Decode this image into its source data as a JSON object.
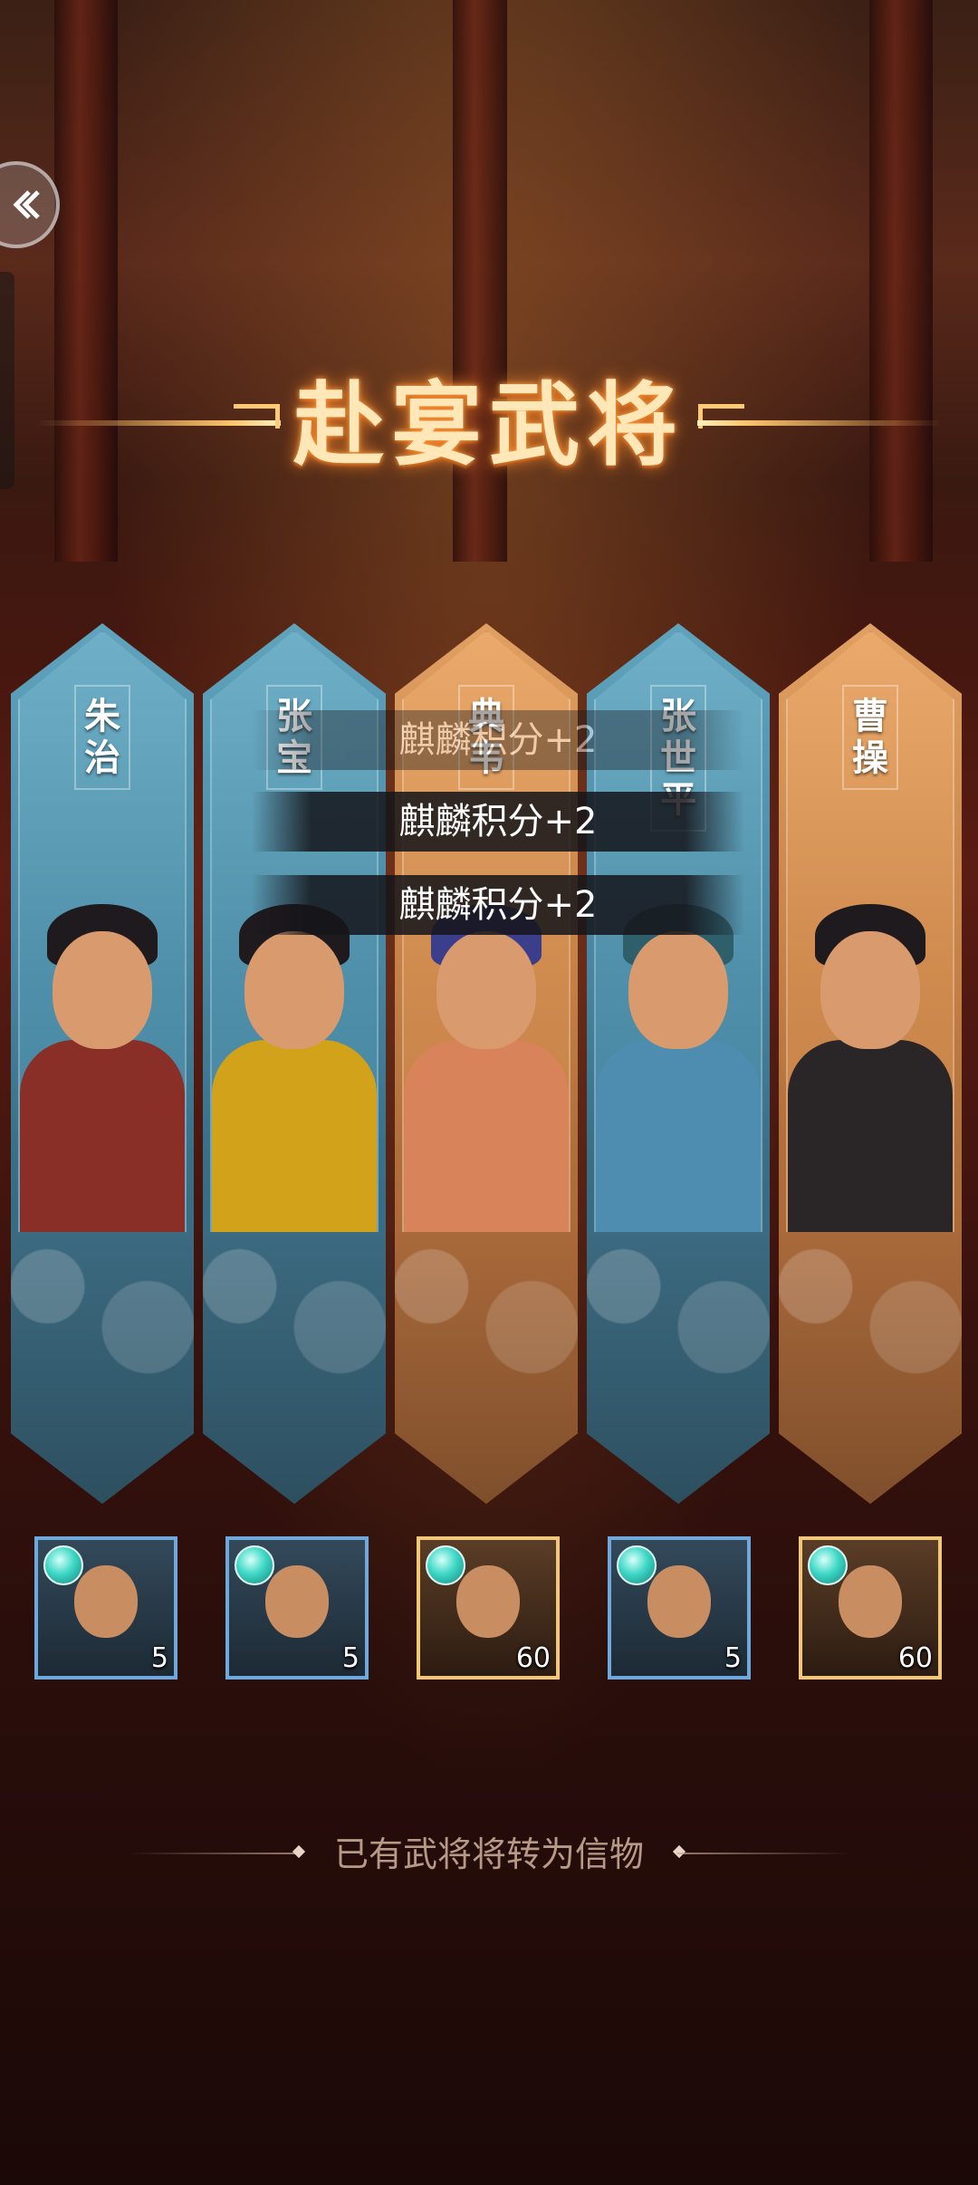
{
  "title": "赴宴武将",
  "generals": [
    {
      "name": "朱治",
      "theme": "blue",
      "count": "5",
      "robe": "#8a2f27"
    },
    {
      "name": "张宝",
      "theme": "blue",
      "count": "5",
      "robe": "#d2a21a"
    },
    {
      "name": "典韦",
      "theme": "gold",
      "count": "60",
      "robe": "#d9835a"
    },
    {
      "name": "张世平",
      "theme": "blue",
      "count": "5",
      "robe": "#4f8db0"
    },
    {
      "name": "曹操",
      "theme": "gold",
      "count": "60",
      "robe": "#2a2526"
    }
  ],
  "toasts": [
    "麒麟积分+2",
    "麒麟积分+2",
    "麒麟积分+2"
  ],
  "footnote": "已有武将将转为信物",
  "colors": {
    "title": "#ffe7b8",
    "blue_card": "#4a8aa6",
    "gold_card": "#c98448",
    "gem": "#3ed7c6"
  }
}
